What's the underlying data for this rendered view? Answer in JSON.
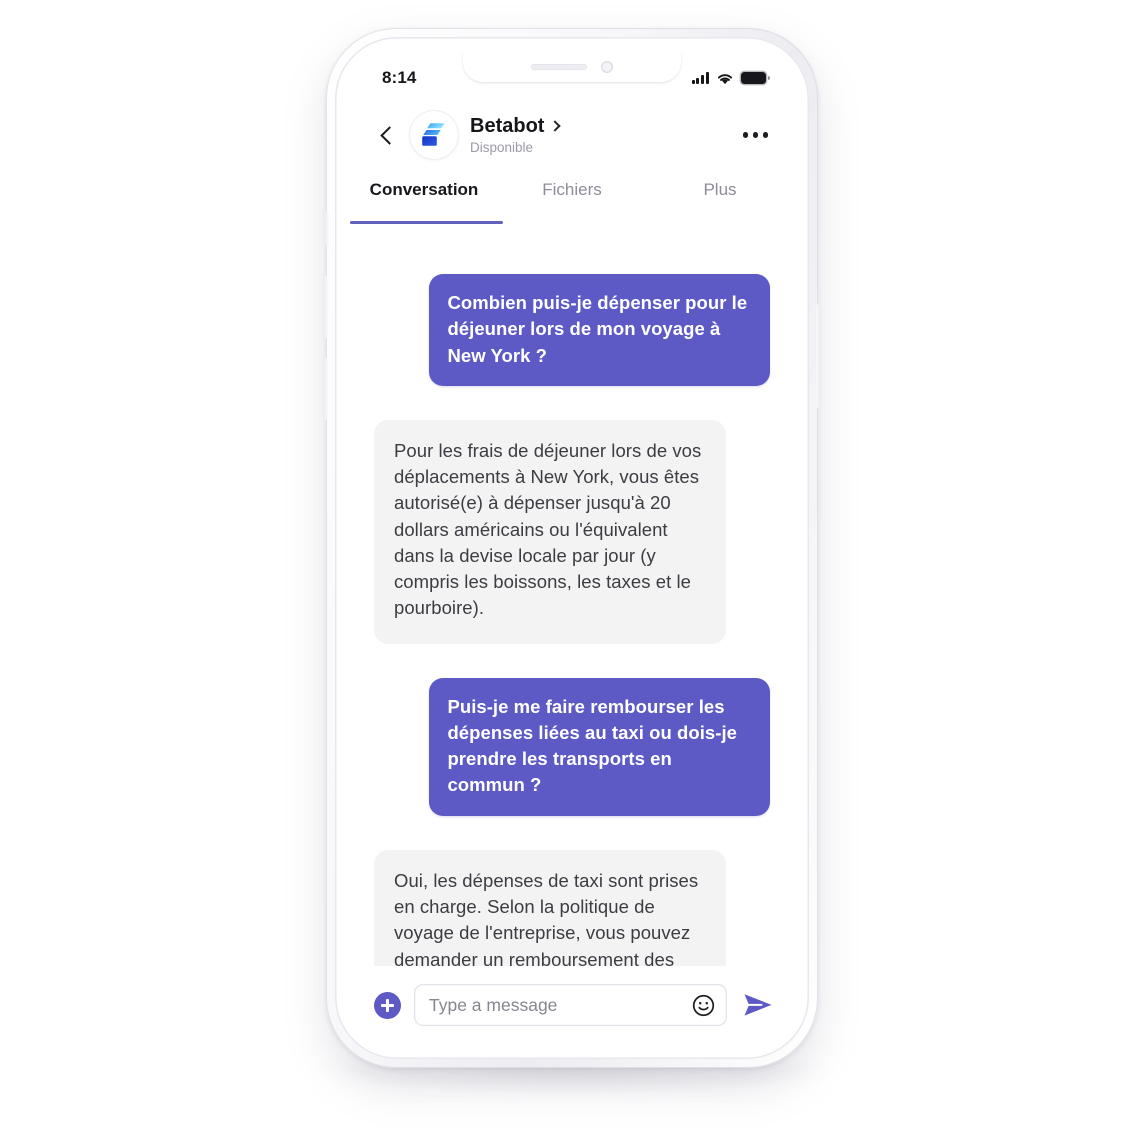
{
  "device": {
    "type": "smartphone-mockup",
    "frame_color": "#f5f5f8"
  },
  "status_bar": {
    "time": "8:14",
    "icons": [
      "cellular-signal-icon",
      "wifi-icon",
      "battery-icon"
    ],
    "signal_bars": 4,
    "battery_full": true
  },
  "header": {
    "back_icon": "chevron-left-icon",
    "avatar_icon": "betabot-logo-icon",
    "bot_name": "Betabot",
    "name_chevron_icon": "chevron-right-icon",
    "status": "Disponible",
    "more_icon": "more-options-icon"
  },
  "tabs": {
    "active_index": 0,
    "items": [
      {
        "label": "Conversation"
      },
      {
        "label": "Fichiers"
      },
      {
        "label": "Plus"
      }
    ]
  },
  "conversation": {
    "messages": [
      {
        "sender": "user",
        "text": "Combien puis-je dépenser pour le déjeuner lors de mon voyage à New York ?"
      },
      {
        "sender": "bot",
        "text": "Pour les frais de déjeuner lors de vos déplacements à New York, vous êtes autorisé(e) à dépenser jusqu'à 20 dollars américains ou l'équivalent dans la devise locale par jour (y compris les boissons, les taxes et le pourboire)."
      },
      {
        "sender": "user",
        "text": "Puis-je me faire rembourser les dépenses liées au taxi ou dois-je prendre les transports en commun ?"
      },
      {
        "sender": "bot",
        "text": "Oui, les dépenses de taxi sont prises en charge. Selon la politique de voyage de l'entreprise, vous pouvez demander un remboursement des frais de taxi du domicile à l'aéroport, de l'aéroport à l'hôtel, et de l'aéroport aux bureaux de l'entreprise."
      }
    ]
  },
  "input_bar": {
    "attach_icon": "plus-circle-icon",
    "placeholder": "Type a message",
    "value": "",
    "emoji_icon": "smiley-face-icon",
    "send_icon": "send-arrow-icon"
  },
  "colors": {
    "accent_purple": "#5d59c5",
    "tab_underline": "#6260bd",
    "bot_bubble_bg": "#f3f3f4",
    "bot_bubble_text": "#3c3c42",
    "user_bubble_text": "#ffffff",
    "muted_text": "#9b9ba6",
    "logo_dark_blue": "#1f46d8",
    "logo_light_blue": "#5fc8f8"
  }
}
